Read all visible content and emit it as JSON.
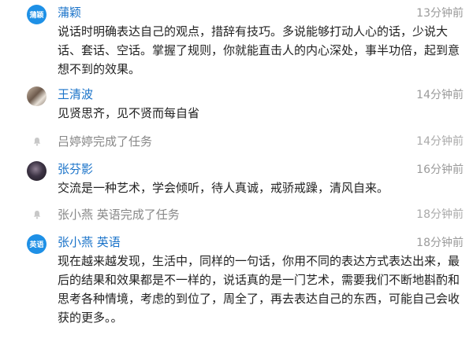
{
  "feed": [
    {
      "type": "comment",
      "avatar": {
        "kind": "badge",
        "text": "蒲颖"
      },
      "name": "蒲颖",
      "time": "13分钟前",
      "text": "说话时明确表达自己的观点，措辞有技巧。多说能够打动人心的话，少说大话、套话、空话。掌握了规则，你就能直击人的内心深处，事半功倍，起到意想不到的效果。"
    },
    {
      "type": "comment",
      "avatar": {
        "kind": "photo"
      },
      "name": "王清波",
      "time": "14分钟前",
      "text": "见贤思齐，见不贤而每自省"
    },
    {
      "type": "notice",
      "icon": "bell-icon",
      "text": "吕婷婷完成了任务",
      "time": "14分钟前"
    },
    {
      "type": "comment",
      "avatar": {
        "kind": "photo"
      },
      "name": "张芬影",
      "time": "16分钟前",
      "text": "交流是一种艺术，学会倾听，待人真诚，戒骄戒躁，清风自来。"
    },
    {
      "type": "notice",
      "icon": "bell-icon",
      "text": "张小燕 英语完成了任务",
      "time": "18分钟前"
    },
    {
      "type": "comment",
      "avatar": {
        "kind": "badge",
        "text": "英语"
      },
      "name": "张小燕 英语",
      "time": "18分钟前",
      "text": "现在越来越发现，生活中，同样的一句话，你用不同的表达方式表达出来，最后的结果和效果都是不一样的，说话真的是一门艺术，需要我们不断地斟酌和思考各种情境，考虑的到位了，周全了，再去表达自己的东西，可能自己会收获的更多。。"
    }
  ],
  "colors": {
    "name": "#1a73c9",
    "badge": "#1e90e6",
    "time": "#9a9a9a"
  }
}
